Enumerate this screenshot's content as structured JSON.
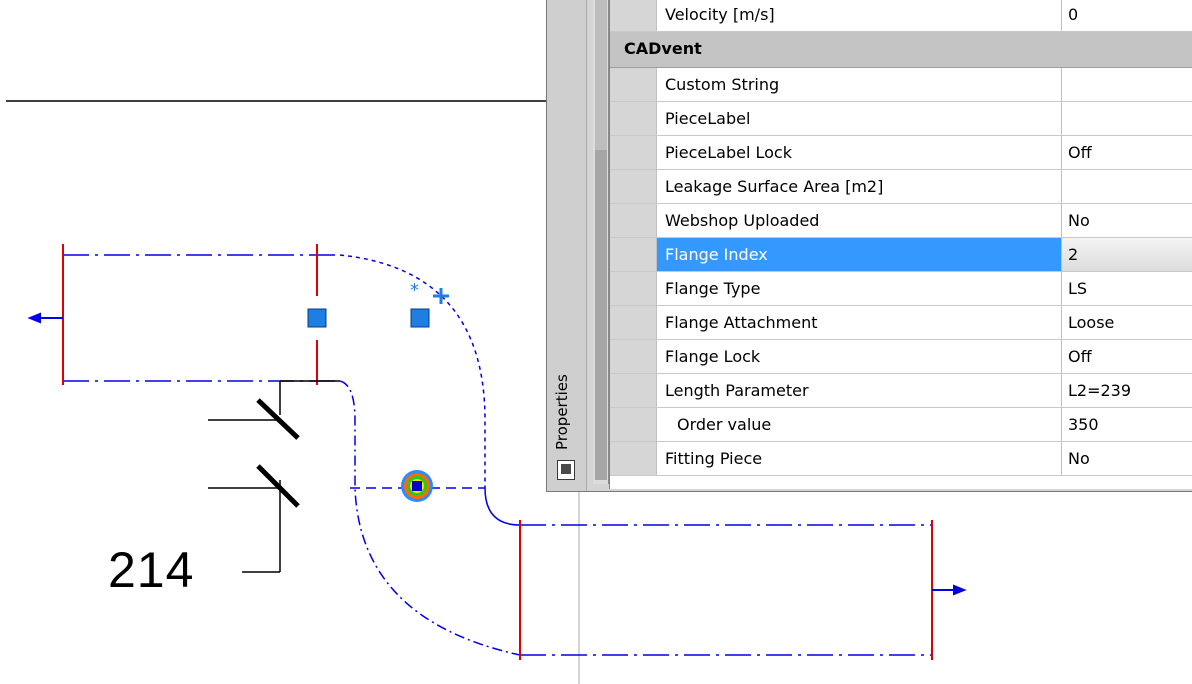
{
  "drawing": {
    "dimension_label": "214",
    "colors": {
      "duct_line": "#0000e6",
      "flange": "#e00000",
      "grip": "#1e7fe0",
      "dim_line": "#000000",
      "crosshair": "#9a9a9a"
    },
    "icons": [
      "grip-icon",
      "cursor-cross-icon",
      "snap-marker-icon",
      "flow-arrow-icon"
    ]
  },
  "properties": {
    "palette_title": "Properties",
    "top_row": {
      "name": "Velocity [m/s]",
      "value": "0"
    },
    "category": "CADvent",
    "rows": [
      {
        "name": "Custom String",
        "value": ""
      },
      {
        "name": "PieceLabel",
        "value": ""
      },
      {
        "name": "PieceLabel Lock",
        "value": "Off"
      },
      {
        "name": "Leakage Surface Area [m2]",
        "value": ""
      },
      {
        "name": "Webshop Uploaded",
        "value": "No"
      },
      {
        "name": "Flange Index",
        "value": "2"
      },
      {
        "name": "Flange Type",
        "value": "LS"
      },
      {
        "name": "Flange Attachment",
        "value": "Loose"
      },
      {
        "name": "Flange Lock",
        "value": "Off"
      },
      {
        "name": "Length Parameter",
        "value": "L2=239"
      },
      {
        "name": "Order value",
        "value": "350"
      },
      {
        "name": "Fitting Piece",
        "value": "No"
      }
    ],
    "selected_row": "Flange Index",
    "selection_color": "#3399ff"
  }
}
